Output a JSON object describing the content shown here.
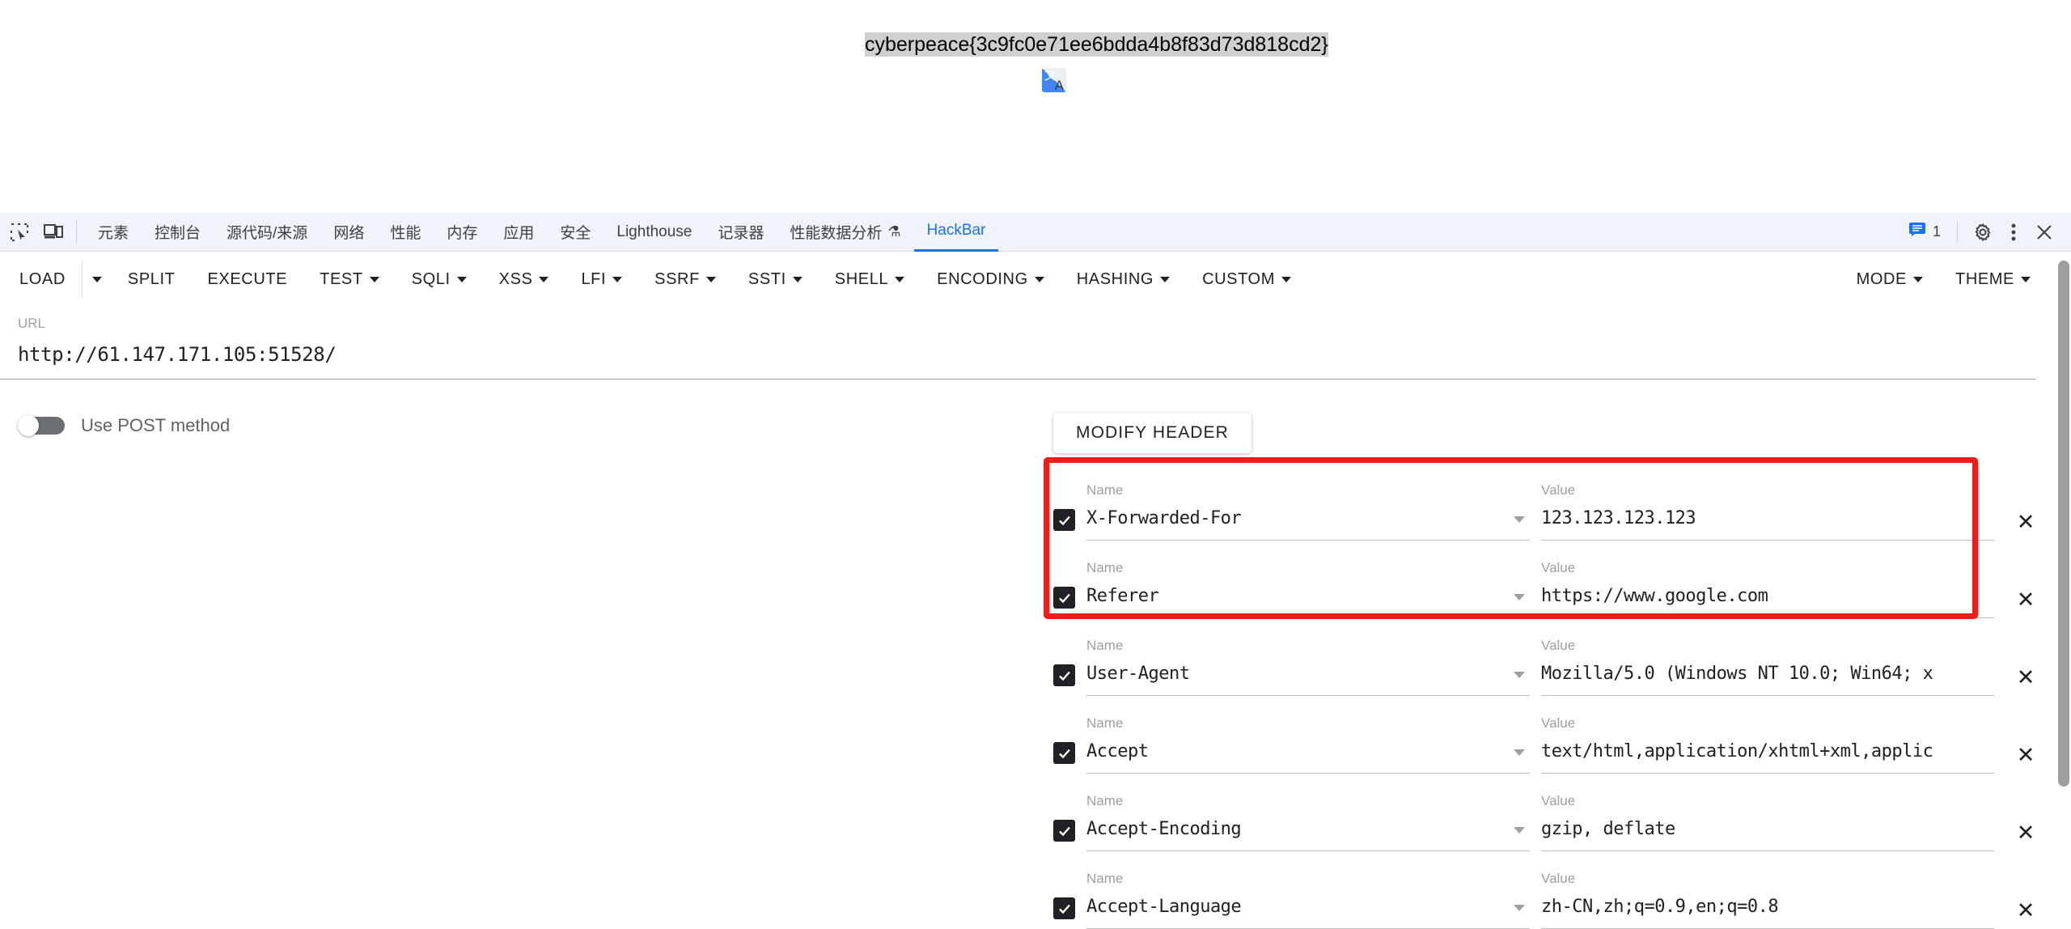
{
  "page": {
    "flag_text": "cyberpeace{3c9fc0e71ee6bdda4b8f83d73d818cd2}",
    "translate_icon": {
      "name": "google-translate-icon",
      "zh_glyph": "文",
      "latin_glyph": "A"
    }
  },
  "devtools": {
    "inspect_icon": "inspect-element-icon",
    "device_icon": "device-toolbar-icon",
    "tabs": [
      {
        "label": "元素",
        "active": false
      },
      {
        "label": "控制台",
        "active": false
      },
      {
        "label": "源代码/来源",
        "active": false
      },
      {
        "label": "网络",
        "active": false
      },
      {
        "label": "性能",
        "active": false
      },
      {
        "label": "内存",
        "active": false
      },
      {
        "label": "应用",
        "active": false
      },
      {
        "label": "安全",
        "active": false
      },
      {
        "label": "Lighthouse",
        "active": false
      },
      {
        "label": "记录器",
        "active": false
      },
      {
        "label": "性能数据分析",
        "active": false,
        "badge_icon": "flask-icon"
      },
      {
        "label": "HackBar",
        "active": true
      }
    ],
    "message_count": "1",
    "message_icon": "message-icon",
    "settings_icon": "gear-icon",
    "more_icon": "kebab-menu-icon",
    "close_icon": "close-icon",
    "accent_color": "#1a73e8",
    "bar_background": "#f0f3f9"
  },
  "hackbar": {
    "buttons": [
      {
        "label": "LOAD",
        "has_caret": false,
        "split_caret": true
      },
      {
        "label": "SPLIT",
        "has_caret": false,
        "split_caret": false
      },
      {
        "label": "EXECUTE",
        "has_caret": false,
        "split_caret": false
      },
      {
        "label": "TEST",
        "has_caret": true,
        "split_caret": false
      },
      {
        "label": "SQLI",
        "has_caret": true,
        "split_caret": false
      },
      {
        "label": "XSS",
        "has_caret": true,
        "split_caret": false
      },
      {
        "label": "LFI",
        "has_caret": true,
        "split_caret": false
      },
      {
        "label": "SSRF",
        "has_caret": true,
        "split_caret": false
      },
      {
        "label": "SSTI",
        "has_caret": true,
        "split_caret": false
      },
      {
        "label": "SHELL",
        "has_caret": true,
        "split_caret": false
      },
      {
        "label": "ENCODING",
        "has_caret": true,
        "split_caret": false
      },
      {
        "label": "HASHING",
        "has_caret": true,
        "split_caret": false
      },
      {
        "label": "CUSTOM",
        "has_caret": true,
        "split_caret": false
      }
    ],
    "right_buttons": [
      {
        "label": "MODE",
        "has_caret": true
      },
      {
        "label": "THEME",
        "has_caret": true
      }
    ]
  },
  "request": {
    "url_label": "URL",
    "url_value": "http://61.147.171.105:51528/",
    "post_toggle_label": "Use POST method",
    "post_toggle_on": false
  },
  "headers_panel": {
    "modify_button_label": "MODIFY HEADER",
    "name_label": "Name",
    "value_label": "Value",
    "delete_icon": "close-icon",
    "highlight_color": "#f01c1c",
    "rows": [
      {
        "checked": true,
        "name": "X-Forwarded-For",
        "value": "123.123.123.123",
        "highlighted": true
      },
      {
        "checked": true,
        "name": "Referer",
        "value": "https://www.google.com",
        "highlighted": true
      },
      {
        "checked": true,
        "name": "User-Agent",
        "value": "Mozilla/5.0 (Windows NT 10.0; Win64; x",
        "highlighted": false
      },
      {
        "checked": true,
        "name": "Accept",
        "value": "text/html,application/xhtml+xml,applic",
        "highlighted": false
      },
      {
        "checked": true,
        "name": "Accept-Encoding",
        "value": "gzip, deflate",
        "highlighted": false
      },
      {
        "checked": true,
        "name": "Accept-Language",
        "value": "zh-CN,zh;q=0.9,en;q=0.8",
        "highlighted": false
      }
    ]
  }
}
